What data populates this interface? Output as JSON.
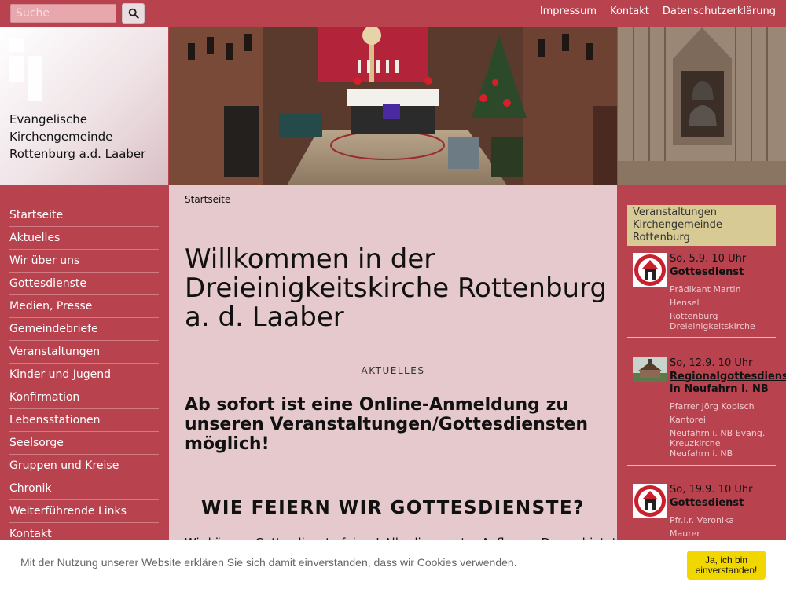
{
  "search": {
    "placeholder": "Suche",
    "icon": "search-icon"
  },
  "top_links": [
    "Impressum",
    "Kontakt",
    "Datenschutzerklärung"
  ],
  "site": {
    "title_lines": [
      "Evangelische",
      "Kirchengemeinde",
      "Rottenburg a.d. Laaber"
    ]
  },
  "nav": [
    "Startseite",
    "Aktuelles",
    "Wir über uns",
    "Gottesdienste",
    "Medien, Presse",
    "Gemeindebriefe",
    "Veranstaltungen",
    "Kinder und Jugend",
    "Konfirmation",
    "Lebensstationen",
    "Seelsorge",
    "Gruppen und Kreise",
    "Chronik",
    "Weiterführende Links",
    "Kontakt"
  ],
  "main": {
    "breadcrumb": "Startseite",
    "welcome": "Willkommen in der Dreieinigkeitskirche Rottenburg a. d. Laaber",
    "section_label": "AKTUELLES",
    "news_headline": "Ab sofort ist eine Online-Anmeldung zu unseren Veranstaltungen/Gottesdiensten möglich!",
    "sub_heading": "WIE FEIERN WIR GOTTESDIENSTE?",
    "cut_text": "Wir können Gottesdienste feiern! Allerdings unter Auflagen. Das gebietet"
  },
  "events_header": "Veranstaltungen Kirchengemeinde Rottenburg",
  "events": [
    {
      "date": "So, 5.9. 10 Uhr",
      "title": "Gottesdienst",
      "meta": [
        "Prädikant Martin",
        "Hensel",
        "Rottenburg",
        "Dreieinigkeitskirche"
      ],
      "thumb": "church-logo"
    },
    {
      "date": "So, 12.9. 10 Uhr",
      "title": "Regionalgottesdienst in Neufahrn i. NB",
      "meta": [
        "Pfarrer Jörg Kopisch",
        "Kantorei",
        "Neufahrn i. NB Evang.",
        "Kreuzkirche",
        "Neufahrn i. NB"
      ],
      "thumb": "church-photo"
    },
    {
      "date": "So, 19.9. 10 Uhr",
      "title": "Gottesdienst",
      "meta": [
        "Pfr.i.r. Veronika",
        "Maurer"
      ],
      "thumb": "church-logo"
    }
  ],
  "cookie": {
    "text": "Mit der Nutzung unserer Website erklären Sie sich damit einverstanden, dass wir Cookies verwenden.",
    "button": "Ja, ich bin einverstanden!"
  },
  "colors": {
    "primary": "#b8434f",
    "content_bg": "#e6c9cd",
    "accent_gold": "#d8ca94",
    "cookie_button": "#f1d600"
  }
}
